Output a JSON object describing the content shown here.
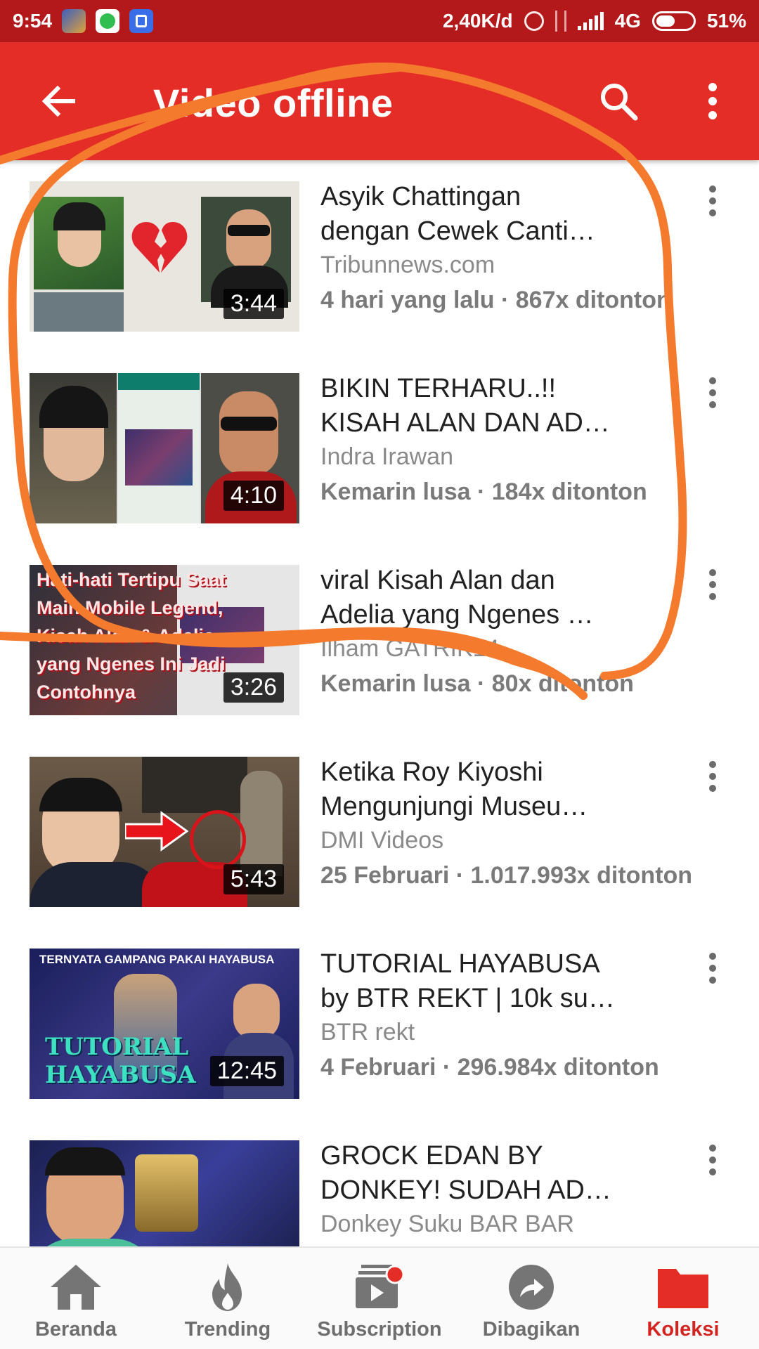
{
  "status_bar": {
    "time": "9:54",
    "network_speed": "2,40K/d",
    "network_type": "4G",
    "battery": "51%"
  },
  "app_bar": {
    "title": "Video offline",
    "back_icon": "arrow-back-icon",
    "search_icon": "search-icon",
    "more_icon": "more-vert-icon"
  },
  "videos": [
    {
      "title": "Asyik Chattingan\ndengan Cewek Canti…",
      "channel": "Tribunnews.com",
      "meta": "4 hari yang lalu · 867x ditonton",
      "duration": "3:44"
    },
    {
      "title": "BIKIN TERHARU..!!\nKISAH ALAN DAN AD…",
      "channel": "Indra Irawan",
      "meta": "Kemarin lusa · 184x ditonton",
      "duration": "4:10"
    },
    {
      "title": "viral Kisah Alan dan\nAdelia yang Ngenes …",
      "channel": "Ilham GATRIK14",
      "meta": "Kemarin lusa · 80x ditonton",
      "duration": "3:26",
      "thumb_text": [
        "Hati-hati Tertipu Saat",
        "Main Mobile Legend,",
        "Kisah Alan & Adelia",
        "yang Ngenes Ini Jadi",
        "Contohnya"
      ]
    },
    {
      "title": "Ketika Roy Kiyoshi\nMengunjungi Museu…",
      "channel": "DMI Videos",
      "meta": "25 Februari · 1.017.993x ditonton",
      "duration": "5:43"
    },
    {
      "title": "TUTORIAL HAYABUSA\nby BTR REKT | 10k su…",
      "channel": "BTR rekt",
      "meta": "4 Februari · 296.984x ditonton",
      "duration": "12:45",
      "thumb_text": [
        "TERNYATA GAMPANG PAKAI HAYABUSA",
        "TUTORIAL",
        "HAYABUSA"
      ]
    },
    {
      "title": "GROCK EDAN BY\nDONKEY! SUDAH AD…",
      "channel": "Donkey Suku BAR BAR",
      "meta": "",
      "duration": ""
    }
  ],
  "bottom_nav": [
    {
      "label": "Beranda",
      "icon": "home-icon"
    },
    {
      "label": "Trending",
      "icon": "flame-icon"
    },
    {
      "label": "Subscription",
      "icon": "subscriptions-icon"
    },
    {
      "label": "Dibagikan",
      "icon": "share-icon"
    },
    {
      "label": "Koleksi",
      "icon": "folder-icon",
      "active": true
    }
  ],
  "colors": {
    "status_bar": "#b3191b",
    "app_bar": "#e52d27",
    "active_tab": "#d32421",
    "annotation_stroke": "#f47a2d"
  }
}
